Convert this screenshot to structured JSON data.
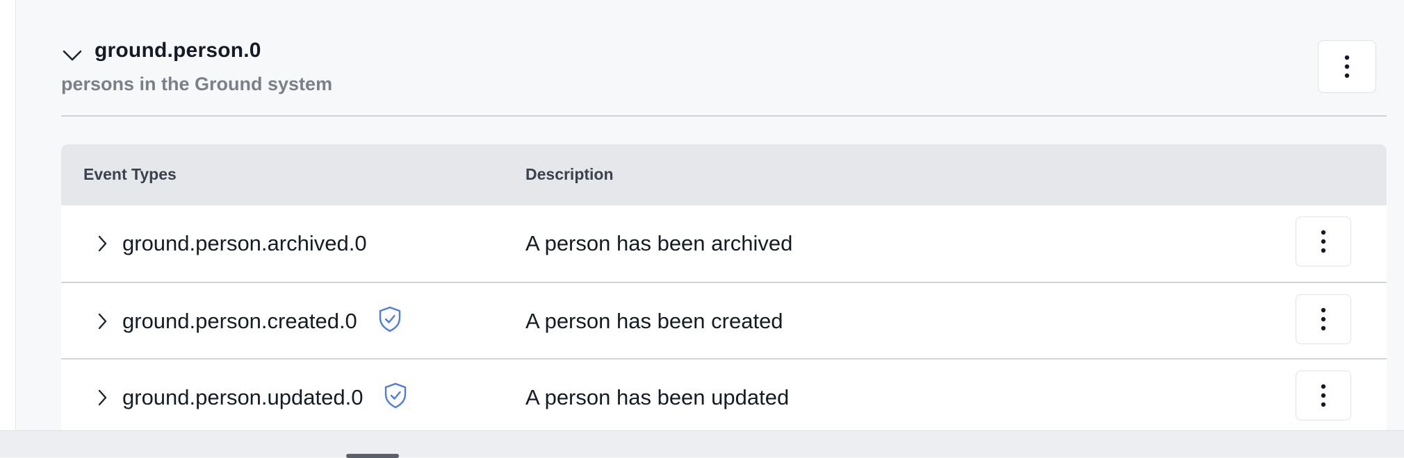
{
  "group": {
    "title": "ground.person.0",
    "subtitle": "persons in the Ground system"
  },
  "table": {
    "columns": [
      "Event Types",
      "Description"
    ],
    "rows": [
      {
        "name": "ground.person.archived.0",
        "description": "A person has been archived",
        "verified": false
      },
      {
        "name": "ground.person.created.0",
        "description": "A person has been created",
        "verified": true
      },
      {
        "name": "ground.person.updated.0",
        "description": "A person has been updated",
        "verified": true
      }
    ]
  },
  "icons": {
    "group_toggle": "chevron-down-icon",
    "row_toggle": "chevron-right-icon",
    "menu": "kebab-menu-icon",
    "verified": "verified-shield-icon"
  },
  "colors": {
    "badge": "#4a7be8",
    "header_bg": "#e5e7eb",
    "text": "#151b26",
    "muted": "#7a7f89"
  }
}
